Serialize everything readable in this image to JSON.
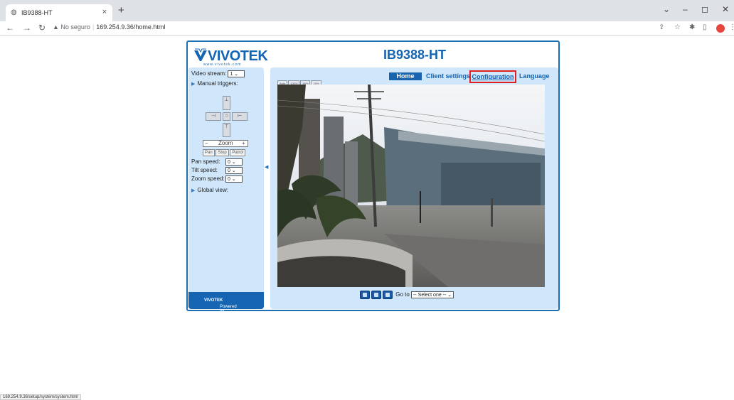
{
  "browser": {
    "tab_title": "IB9388-HT",
    "url_warning": "▲ No seguro",
    "url": "169.254.9.36/home.html",
    "status_url": "169.254.9.36/setup/system/system.html"
  },
  "page": {
    "brand": "VIVOTEK",
    "brand_url": "www.vivotek.com",
    "model": "IB9388-HT",
    "nav": {
      "home": "Home",
      "client_settings": "Client settings",
      "configuration": "Configuration",
      "language": "Language"
    },
    "left": {
      "video_stream_label": "Video stream:",
      "video_stream_value": "1",
      "manual_triggers": "Manual triggers:",
      "zoom_minus": "−",
      "zoom_label": "Zoom",
      "zoom_plus": "+",
      "pan": "Pan",
      "stop": "Stop",
      "patrol": "Patrol",
      "pan_speed_label": "Pan speed:",
      "pan_speed_value": "0",
      "tilt_speed_label": "Tilt speed:",
      "tilt_speed_value": "0",
      "zoom_speed_label": "Zoom speed:",
      "zoom_speed_value": "0",
      "global_view": "Global view:",
      "powered_by": "Powered by",
      "powered_brand": "VIVOTEK"
    },
    "size_buttons": [
      "Auto",
      "100%",
      "50%",
      "25%"
    ],
    "goto_label": "Go to",
    "goto_value": "-- Select one --"
  }
}
